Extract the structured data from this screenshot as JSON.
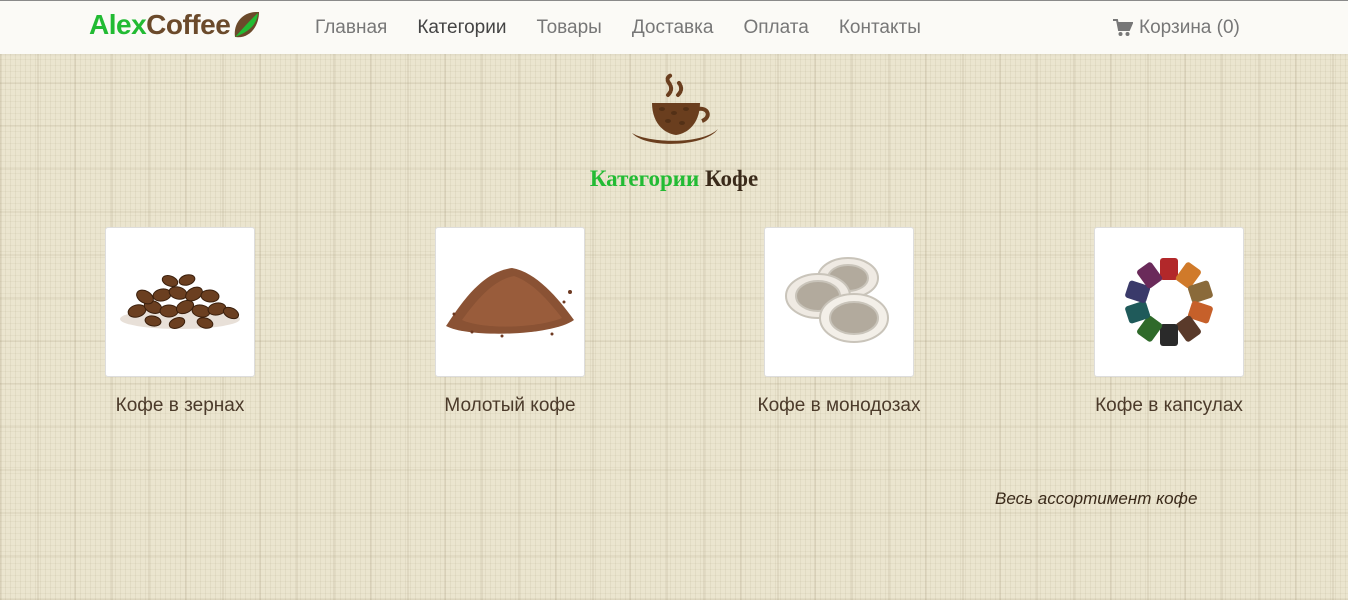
{
  "header": {
    "logo": {
      "part1": "Alex",
      "part2": "Coffee"
    },
    "nav": [
      {
        "label": "Главная"
      },
      {
        "label": "Категории"
      },
      {
        "label": "Товары"
      },
      {
        "label": "Доставка"
      },
      {
        "label": "Оплата"
      },
      {
        "label": "Контакты"
      }
    ],
    "cart_label": "Корзина (0)"
  },
  "main": {
    "heading": {
      "part1": "Категории",
      "part2": "Кофе"
    },
    "categories": [
      {
        "label": "Кофе в зернах",
        "icon": "coffee-beans-image"
      },
      {
        "label": "Молотый кофе",
        "icon": "ground-coffee-image"
      },
      {
        "label": "Кофе в монодозах",
        "icon": "coffee-pods-image"
      },
      {
        "label": "Кофе в капсулах",
        "icon": "coffee-capsules-image"
      }
    ],
    "all_link": "Весь ассортимент кофе"
  },
  "colors": {
    "brand_green": "#22bb33",
    "brand_brown": "#6b4a2b",
    "background": "#ebe5cf"
  }
}
